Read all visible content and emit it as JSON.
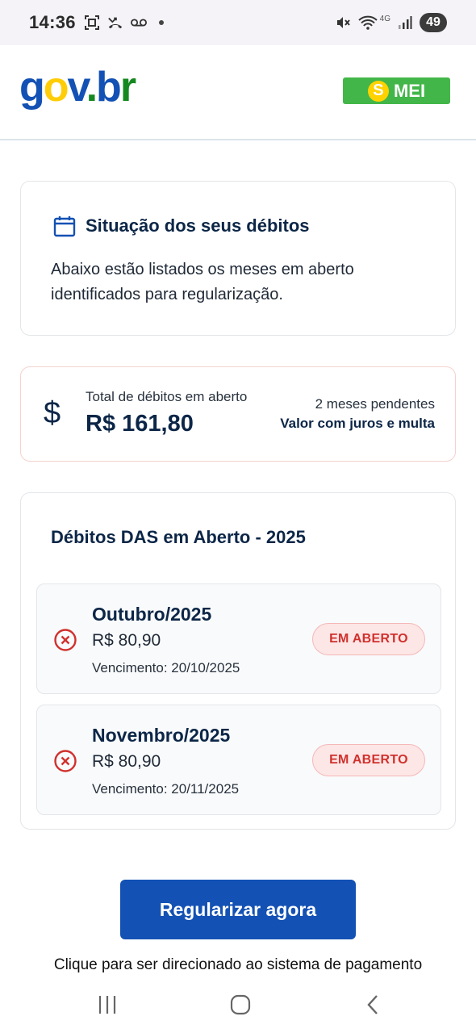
{
  "status_bar": {
    "time": "14:36",
    "network": "4G",
    "battery": "49"
  },
  "header": {
    "logo": {
      "g": "g",
      "o": "o",
      "v": "v",
      "dot": ".",
      "b": "b",
      "r": "r"
    },
    "mei_label": "MEI",
    "mei_s": "S",
    "colors": {
      "brand_blue": "#1351b4",
      "brand_green": "#168821",
      "brand_yellow": "#ffcd07",
      "mei_green": "#43b649"
    }
  },
  "situation": {
    "icon": "calendar-icon",
    "title": "Situação dos seus débitos",
    "description": "Abaixo estão listados os meses em aberto identificados para regularização."
  },
  "total": {
    "icon": "dollar-icon",
    "symbol": "$",
    "label": "Total de débitos em aberto",
    "value": "R$ 161,80",
    "pending": "2 meses pendentes",
    "note": "Valor com juros e multa"
  },
  "debts": {
    "title": "Débitos DAS em Aberto - 2025",
    "items": [
      {
        "month": "Outubro/2025",
        "amount": "R$ 80,90",
        "due": "Vencimento: 20/10/2025",
        "status": "EM ABERTO",
        "icon": "error-circle-icon"
      },
      {
        "month": "Novembro/2025",
        "amount": "R$ 80,90",
        "due": "Vencimento: 20/11/2025",
        "status": "EM ABERTO",
        "icon": "error-circle-icon"
      }
    ]
  },
  "cta": {
    "label": "Regularizar agora",
    "hint": "Clique para ser direcionado ao sistema de pagamento"
  },
  "nav": {
    "icons": [
      "recent-apps-icon",
      "home-icon",
      "back-icon"
    ]
  }
}
